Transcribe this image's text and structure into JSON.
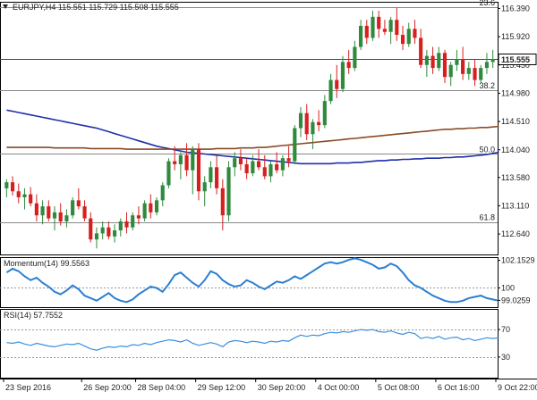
{
  "header": {
    "symbol_line": "EURJPY,H4  115.551 115.729 115.508 115.555"
  },
  "colors": {
    "bull": "#2f8a3e",
    "bear": "#d6201f",
    "ma_blue": "#1f2fa8",
    "ma_brown": "#8a4a24",
    "momentum": "#2b7fd2",
    "rsi": "#3a8fe0",
    "price_box": "#ffffff"
  },
  "chart_data": [
    {
      "type": "candlestick",
      "title": "EURJPY,H4",
      "ohlc_header": [
        115.551,
        115.729,
        115.508,
        115.555
      ],
      "ylim": [
        112.3,
        116.5
      ],
      "y_ticks": [
        "116.390",
        "115.920",
        "115.450",
        "114.980",
        "114.510",
        "114.040",
        "113.580",
        "113.110",
        "112.640"
      ],
      "y_tick_values": [
        116.39,
        115.92,
        115.45,
        114.98,
        114.51,
        114.04,
        113.58,
        113.11,
        112.64
      ],
      "current_price": 115.555,
      "current_price_label": "115.555",
      "fib_levels": [
        {
          "label": "23.6",
          "value": 116.41
        },
        {
          "label": "38.2",
          "value": 115.03
        },
        {
          "label": "50.0",
          "value": 113.97
        },
        {
          "label": "61.8",
          "value": 112.84
        }
      ],
      "x_labels": [
        "23 Sep 2016",
        "26 Sep 20:00",
        "28 Sep 04:00",
        "29 Sep 12:00",
        "30 Sep 20:00",
        "4 Oct 00:00",
        "5 Oct 08:00",
        "6 Oct 16:00",
        "9 Oct 22:00"
      ],
      "x_label_index": [
        0,
        13,
        22,
        32,
        42,
        52,
        62,
        72,
        82
      ],
      "candles": [
        [
          113.4,
          113.55,
          113.25,
          113.5
        ],
        [
          113.5,
          113.6,
          113.28,
          113.35
        ],
        [
          113.35,
          113.48,
          113.15,
          113.25
        ],
        [
          113.25,
          113.4,
          113.05,
          113.3
        ],
        [
          113.3,
          113.42,
          113.1,
          113.15
        ],
        [
          113.15,
          113.3,
          112.85,
          112.95
        ],
        [
          112.95,
          113.2,
          112.8,
          113.1
        ],
        [
          113.1,
          113.2,
          112.85,
          112.9
        ],
        [
          112.9,
          113.1,
          112.7,
          113.0
        ],
        [
          113.0,
          113.15,
          112.78,
          112.85
        ],
        [
          112.85,
          113.05,
          112.75,
          112.95
        ],
        [
          112.95,
          113.25,
          112.9,
          113.2
        ],
        [
          113.2,
          113.4,
          113.05,
          113.1
        ],
        [
          113.1,
          113.2,
          112.85,
          112.9
        ],
        [
          112.9,
          113.0,
          112.5,
          112.55
        ],
        [
          112.55,
          112.75,
          112.4,
          112.65
        ],
        [
          112.65,
          112.85,
          112.55,
          112.75
        ],
        [
          112.75,
          112.85,
          112.55,
          112.6
        ],
        [
          112.6,
          112.8,
          112.5,
          112.7
        ],
        [
          112.7,
          112.9,
          112.6,
          112.85
        ],
        [
          112.85,
          113.0,
          112.65,
          112.75
        ],
        [
          112.75,
          113.0,
          112.7,
          112.95
        ],
        [
          112.95,
          113.1,
          112.8,
          112.9
        ],
        [
          112.9,
          113.2,
          112.85,
          113.15
        ],
        [
          113.15,
          113.3,
          112.9,
          113.0
        ],
        [
          113.0,
          113.25,
          112.95,
          113.2
        ],
        [
          113.2,
          113.5,
          113.1,
          113.45
        ],
        [
          113.45,
          113.9,
          113.4,
          113.85
        ],
        [
          113.85,
          114.1,
          113.7,
          113.8
        ],
        [
          113.8,
          114.0,
          113.55,
          113.95
        ],
        [
          113.95,
          114.15,
          113.6,
          113.7
        ],
        [
          113.7,
          114.1,
          113.3,
          114.05
        ],
        [
          114.05,
          114.15,
          113.2,
          113.35
        ],
        [
          113.35,
          113.6,
          113.1,
          113.5
        ],
        [
          113.5,
          113.85,
          113.4,
          113.75
        ],
        [
          113.75,
          113.95,
          113.3,
          113.4
        ],
        [
          113.4,
          113.55,
          112.7,
          112.95
        ],
        [
          112.95,
          113.85,
          112.85,
          113.75
        ],
        [
          113.75,
          114.0,
          113.6,
          113.9
        ],
        [
          113.9,
          114.05,
          113.7,
          113.8
        ],
        [
          113.8,
          113.9,
          113.55,
          113.65
        ],
        [
          113.65,
          113.95,
          113.6,
          113.85
        ],
        [
          113.85,
          114.05,
          113.7,
          113.75
        ],
        [
          113.75,
          113.95,
          113.55,
          113.6
        ],
        [
          113.6,
          113.85,
          113.5,
          113.8
        ],
        [
          113.8,
          114.0,
          113.65,
          113.7
        ],
        [
          113.7,
          113.95,
          113.6,
          113.9
        ],
        [
          113.9,
          114.1,
          113.75,
          113.85
        ],
        [
          113.85,
          114.45,
          113.8,
          114.4
        ],
        [
          114.4,
          114.75,
          114.25,
          114.65
        ],
        [
          114.65,
          114.8,
          114.2,
          114.3
        ],
        [
          114.3,
          114.55,
          114.05,
          114.5
        ],
        [
          114.5,
          114.7,
          114.35,
          114.45
        ],
        [
          114.45,
          114.95,
          114.4,
          114.85
        ],
        [
          114.85,
          115.3,
          114.8,
          115.2
        ],
        [
          115.2,
          115.45,
          114.9,
          115.05
        ],
        [
          115.05,
          115.6,
          115.0,
          115.5
        ],
        [
          115.5,
          115.7,
          115.3,
          115.4
        ],
        [
          115.4,
          115.85,
          115.35,
          115.75
        ],
        [
          115.75,
          116.2,
          115.7,
          116.1
        ],
        [
          116.1,
          116.2,
          115.8,
          115.9
        ],
        [
          115.9,
          116.35,
          115.85,
          116.25
        ],
        [
          116.25,
          116.35,
          115.9,
          116.05
        ],
        [
          116.05,
          116.2,
          115.95,
          116.0
        ],
        [
          116.0,
          116.25,
          115.8,
          116.2
        ],
        [
          116.2,
          116.4,
          115.85,
          115.95
        ],
        [
          115.95,
          116.1,
          115.7,
          115.8
        ],
        [
          115.8,
          116.15,
          115.75,
          116.05
        ],
        [
          116.05,
          116.2,
          115.8,
          115.9
        ],
        [
          115.9,
          116.05,
          115.4,
          115.45
        ],
        [
          115.45,
          115.7,
          115.25,
          115.6
        ],
        [
          115.6,
          115.75,
          115.3,
          115.4
        ],
        [
          115.4,
          115.75,
          115.35,
          115.65
        ],
        [
          115.65,
          115.7,
          115.15,
          115.25
        ],
        [
          115.25,
          115.5,
          115.1,
          115.45
        ],
        [
          115.45,
          115.7,
          115.35,
          115.55
        ],
        [
          115.55,
          115.75,
          115.2,
          115.3
        ],
        [
          115.3,
          115.5,
          115.2,
          115.4
        ],
        [
          115.4,
          115.55,
          115.1,
          115.2
        ],
        [
          115.2,
          115.45,
          115.15,
          115.4
        ],
        [
          115.4,
          115.65,
          115.3,
          115.5
        ],
        [
          115.5,
          115.7,
          115.4,
          115.55
        ]
      ],
      "series": [
        {
          "name": "",
          "color_key": "ma_blue",
          "values": [
            114.7,
            114.68,
            114.66,
            114.64,
            114.62,
            114.6,
            114.58,
            114.56,
            114.54,
            114.52,
            114.5,
            114.48,
            114.46,
            114.44,
            114.42,
            114.4,
            114.37,
            114.34,
            114.31,
            114.28,
            114.25,
            114.22,
            114.19,
            114.16,
            114.13,
            114.1,
            114.08,
            114.06,
            114.04,
            114.02,
            114.0,
            113.99,
            113.98,
            113.97,
            113.96,
            113.95,
            113.94,
            113.93,
            113.92,
            113.91,
            113.9,
            113.89,
            113.88,
            113.87,
            113.86,
            113.85,
            113.84,
            113.83,
            113.82,
            113.81,
            113.81,
            113.81,
            113.81,
            113.81,
            113.81,
            113.82,
            113.82,
            113.82,
            113.83,
            113.83,
            113.84,
            113.85,
            113.86,
            113.86,
            113.87,
            113.87,
            113.88,
            113.88,
            113.89,
            113.89,
            113.9,
            113.9,
            113.9,
            113.91,
            113.91,
            113.92,
            113.92,
            113.93,
            113.94,
            113.95,
            113.96,
            113.98,
            114.0
          ]
        },
        {
          "name": "",
          "color_key": "ma_brown",
          "values": [
            114.08,
            114.08,
            114.08,
            114.08,
            114.08,
            114.08,
            114.08,
            114.08,
            114.07,
            114.07,
            114.07,
            114.07,
            114.07,
            114.07,
            114.06,
            114.06,
            114.06,
            114.06,
            114.06,
            114.06,
            114.05,
            114.05,
            114.05,
            114.05,
            114.05,
            114.05,
            114.05,
            114.05,
            114.05,
            114.05,
            114.05,
            114.05,
            114.05,
            114.05,
            114.05,
            114.06,
            114.06,
            114.06,
            114.06,
            114.07,
            114.07,
            114.07,
            114.08,
            114.08,
            114.09,
            114.1,
            114.11,
            114.12,
            114.13,
            114.14,
            114.15,
            114.16,
            114.17,
            114.18,
            114.19,
            114.2,
            114.21,
            114.22,
            114.23,
            114.24,
            114.25,
            114.26,
            114.27,
            114.28,
            114.29,
            114.3,
            114.31,
            114.32,
            114.33,
            114.34,
            114.35,
            114.36,
            114.37,
            114.38,
            114.38,
            114.39,
            114.39,
            114.4,
            114.4,
            114.41,
            114.41,
            114.42,
            114.43
          ]
        }
      ]
    },
    {
      "type": "line",
      "title": "Momentum(14) 99.5563",
      "ylim": [
        98.5,
        102.4
      ],
      "y_ticks": [
        "102.1529",
        "100",
        "99.0259"
      ],
      "y_tick_values": [
        102.1529,
        100,
        99.0259
      ],
      "reference_line": 100,
      "series": [
        {
          "name": "Momentum(14)",
          "color_key": "momentum",
          "values": [
            101.2,
            101.5,
            101.3,
            100.9,
            100.6,
            100.8,
            100.4,
            100.1,
            99.7,
            99.5,
            99.8,
            100.2,
            99.9,
            99.4,
            99.2,
            99.0,
            99.3,
            99.6,
            99.2,
            99.0,
            98.9,
            99.1,
            99.5,
            99.8,
            100.1,
            100.0,
            99.7,
            100.3,
            101.0,
            101.2,
            100.8,
            100.4,
            100.1,
            100.6,
            101.3,
            101.1,
            100.6,
            100.3,
            100.1,
            100.2,
            100.6,
            100.4,
            100.1,
            99.9,
            100.2,
            100.5,
            100.4,
            100.6,
            100.9,
            100.7,
            101.0,
            101.3,
            101.6,
            101.9,
            102.0,
            101.9,
            102.0,
            102.2,
            102.3,
            102.2,
            102.0,
            101.8,
            101.5,
            101.6,
            101.9,
            101.7,
            101.2,
            100.6,
            100.2,
            100.0,
            99.7,
            99.4,
            99.2,
            99.0,
            98.9,
            98.9,
            99.0,
            99.2,
            99.3,
            99.4,
            99.2,
            99.1,
            99.0
          ]
        }
      ]
    },
    {
      "type": "line",
      "title": "RSI(14) 57.7552",
      "ylim": [
        0,
        100
      ],
      "y_ticks": [
        "70",
        "30"
      ],
      "y_tick_values": [
        70,
        30
      ],
      "series": [
        {
          "name": "RSI(14)",
          "color_key": "rsi",
          "values": [
            51,
            50,
            52,
            49,
            47,
            50,
            48,
            46,
            45,
            47,
            49,
            48,
            50,
            46,
            42,
            40,
            43,
            45,
            44,
            46,
            45,
            48,
            47,
            50,
            48,
            51,
            53,
            55,
            54,
            52,
            55,
            50,
            47,
            49,
            51,
            49,
            45,
            52,
            54,
            53,
            51,
            53,
            52,
            50,
            53,
            52,
            54,
            53,
            58,
            62,
            60,
            62,
            61,
            64,
            66,
            65,
            67,
            66,
            68,
            70,
            69,
            70,
            67,
            66,
            68,
            65,
            63,
            66,
            64,
            57,
            59,
            57,
            60,
            56,
            58,
            59,
            55,
            57,
            54,
            56,
            58,
            57,
            58
          ]
        }
      ]
    }
  ]
}
